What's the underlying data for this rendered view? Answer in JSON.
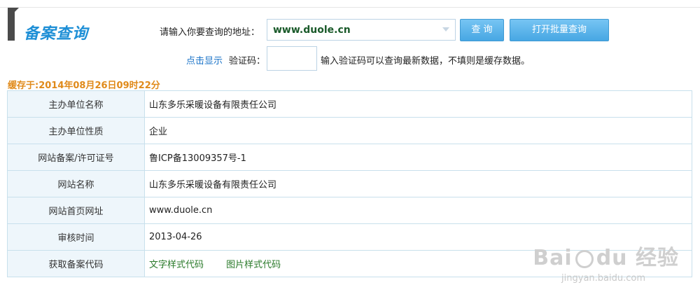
{
  "header": {
    "title": "备案查询",
    "query_label": "请输入你要查询的地址：",
    "query_value": "www.duole.cn",
    "query_button": "查 询",
    "batch_button": "打开批量查询",
    "show_captcha_link": "点击显示",
    "captcha_label": "验证码：",
    "captcha_value": "",
    "captcha_hint": "输入验证码可以查询最新数据，不填则是缓存数据。"
  },
  "cache_time": "缓存于:2014年08月26日09时22分",
  "rows": [
    {
      "label": "主办单位名称",
      "value": "山东多乐采暖设备有限责任公司"
    },
    {
      "label": "主办单位性质",
      "value": "企业"
    },
    {
      "label": "网站备案/许可证号",
      "value": "鲁ICP备13009357号-1"
    },
    {
      "label": "网站名称",
      "value": "山东多乐采暖设备有限责任公司"
    },
    {
      "label": "网站首页网址",
      "value": "www.duole.cn"
    },
    {
      "label": "审核时间",
      "value": "2013-04-26"
    },
    {
      "label": "获取备案代码",
      "links": [
        "文字样式代码",
        "图片样式代码"
      ]
    }
  ],
  "watermark": {
    "text_left": "Bai",
    "text_mid": "du",
    "text_right": "经验",
    "sub": "jingyan.baidu.com"
  }
}
